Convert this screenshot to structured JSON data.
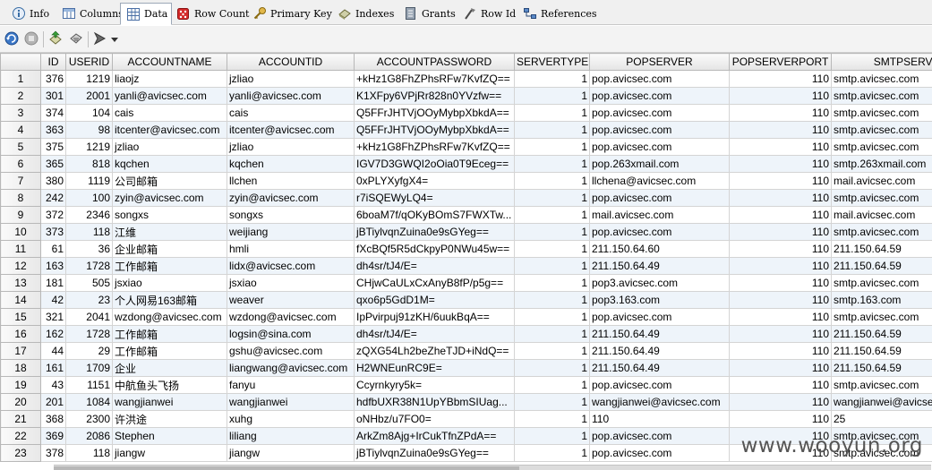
{
  "tabs": [
    {
      "label": "Info",
      "icon": "info-icon",
      "active": false
    },
    {
      "label": "Columns",
      "icon": "columns-icon",
      "active": false
    },
    {
      "label": "Data",
      "icon": "data-grid-icon",
      "active": true
    },
    {
      "label": "Row Count",
      "icon": "dice-icon",
      "active": false
    },
    {
      "label": "Primary Key",
      "icon": "key-icon",
      "active": false
    },
    {
      "label": "Indexes",
      "icon": "indexes-icon",
      "active": false
    },
    {
      "label": "Grants",
      "icon": "grants-icon",
      "active": false
    },
    {
      "label": "Row Id",
      "icon": "row-id-icon",
      "active": false
    },
    {
      "label": "References",
      "icon": "references-icon",
      "active": false
    }
  ],
  "toolbar": {
    "buttons": [
      "refresh-icon",
      "stop-icon",
      "export-icon",
      "save-icon",
      "filter-icon"
    ]
  },
  "grid": {
    "columns": [
      "",
      "ID",
      "USERID",
      "ACCOUNTNAME",
      "ACCOUNTID",
      "ACCOUNTPASSWORD",
      "SERVERTYPE",
      "POPSERVER",
      "POPSERVERPORT",
      "SMTPSERVER"
    ],
    "rows": [
      [
        "1",
        "376",
        "1219",
        "liaojz",
        "jzliao",
        "+kHz1G8FhZPhsRFw7KvfZQ==",
        "1",
        "pop.avicsec.com",
        "110",
        "smtp.avicsec.com"
      ],
      [
        "2",
        "301",
        "2001",
        "yanli@avicsec.com",
        "yanli@avicsec.com",
        "K1XFpy6VPjRr828n0YVzfw==",
        "1",
        "pop.avicsec.com",
        "110",
        "smtp.avicsec.com"
      ],
      [
        "3",
        "374",
        "104",
        "cais",
        "cais",
        "Q5FFrJHTVjOOyMybpXbkdA==",
        "1",
        "pop.avicsec.com",
        "110",
        "smtp.avicsec.com"
      ],
      [
        "4",
        "363",
        "98",
        "itcenter@avicsec.com",
        "itcenter@avicsec.com",
        "Q5FFrJHTVjOOyMybpXbkdA==",
        "1",
        "pop.avicsec.com",
        "110",
        "smtp.avicsec.com"
      ],
      [
        "5",
        "375",
        "1219",
        "jzliao",
        "jzliao",
        "+kHz1G8FhZPhsRFw7KvfZQ==",
        "1",
        "pop.avicsec.com",
        "110",
        "smtp.avicsec.com"
      ],
      [
        "6",
        "365",
        "818",
        "kqchen",
        "kqchen",
        "IGV7D3GWQI2oOia0T9Eceg==",
        "1",
        "pop.263xmail.com",
        "110",
        "smtp.263xmail.com"
      ],
      [
        "7",
        "380",
        "1119",
        "公司邮箱",
        "llchen",
        "0xPLYXyfgX4=",
        "1",
        "llchena@avicsec.com",
        "110",
        "mail.avicsec.com"
      ],
      [
        "8",
        "242",
        "100",
        "zyin@avicsec.com",
        "zyin@avicsec.com",
        "r7iSQEWyLQ4=",
        "1",
        "pop.avicsec.com",
        "110",
        "smtp.avicsec.com"
      ],
      [
        "9",
        "372",
        "2346",
        "songxs",
        "songxs",
        "6boaM7f/qOKyBOmS7FWXTw...",
        "1",
        "mail.avicsec.com",
        "110",
        "mail.avicsec.com"
      ],
      [
        "10",
        "373",
        "118",
        "江维",
        "weijiang",
        "jBTiylvqnZuina0e9sGYeg==",
        "1",
        "pop.avicsec.com",
        "110",
        "smtp.avicsec.com"
      ],
      [
        "11",
        "61",
        "36",
        "企业邮箱",
        "hmli",
        "fXcBQf5R5dCkpyP0NWu45w==",
        "1",
        "211.150.64.60",
        "110",
        "211.150.64.59"
      ],
      [
        "12",
        "163",
        "1728",
        "工作邮箱",
        "lidx@avicsec.com",
        "dh4sr/tJ4/E=",
        "1",
        "211.150.64.49",
        "110",
        "211.150.64.59"
      ],
      [
        "13",
        "181",
        "505",
        "jsxiao",
        "jsxiao",
        "CHjwCaULxCxAnyB8fP/p5g==",
        "1",
        "pop3.avicsec.com",
        "110",
        "smtp.avicsec.com"
      ],
      [
        "14",
        "42",
        "23",
        "个人网易163邮箱",
        "weaver",
        "qxo6p5GdD1M=",
        "1",
        "pop3.163.com",
        "110",
        "smtp.163.com"
      ],
      [
        "15",
        "321",
        "2041",
        "wzdong@avicsec.com",
        "wzdong@avicsec.com",
        "IpPvirpuj91zKH/6uukBqA==",
        "1",
        "pop.avicsec.com",
        "110",
        "smtp.avicsec.com"
      ],
      [
        "16",
        "162",
        "1728",
        "工作邮箱",
        "logsin@sina.com",
        "dh4sr/tJ4/E=",
        "1",
        "211.150.64.49",
        "110",
        "211.150.64.59"
      ],
      [
        "17",
        "44",
        "29",
        "工作邮箱",
        "gshu@avicsec.com",
        "zQXG54Lh2beZheTJD+iNdQ==",
        "1",
        "211.150.64.49",
        "110",
        "211.150.64.59"
      ],
      [
        "18",
        "161",
        "1709",
        "企业",
        "liangwang@avicsec.com",
        "H2WNEunRC9E=",
        "1",
        "211.150.64.49",
        "110",
        "211.150.64.59"
      ],
      [
        "19",
        "43",
        "1151",
        "中航鱼头飞扬",
        "fanyu",
        "Ccyrnkyry5k=",
        "1",
        "pop.avicsec.com",
        "110",
        "smtp.avicsec.com"
      ],
      [
        "20",
        "201",
        "1084",
        "wangjianwei",
        "wangjianwei",
        "hdfbUXR38N1UpYBbmSIUag...",
        "1",
        "wangjianwei@avicsec.com",
        "110",
        "wangjianwei@avicsec"
      ],
      [
        "21",
        "368",
        "2300",
        "许洪途",
        "xuhg",
        "oNHbz/u7FO0=",
        "1",
        "110",
        "110",
        "25"
      ],
      [
        "22",
        "369",
        "2086",
        "Stephen",
        "liliang",
        "ArkZm8Ajg+IrCukTfnZPdA==",
        "1",
        "pop.avicsec.com",
        "110",
        "smtp.avicsec.com"
      ],
      [
        "23",
        "378",
        "118",
        "jiangw",
        "jiangw",
        "jBTiylvqnZuina0e9sGYeg==",
        "1",
        "pop.avicsec.com",
        "110",
        "smtp.avicsec.com"
      ]
    ]
  },
  "watermark": "www.wooyun.org",
  "colors": {
    "header_bg": "#e8e8e8",
    "alt_row": "#eef4fa",
    "grid_line": "#d4d4d4"
  }
}
